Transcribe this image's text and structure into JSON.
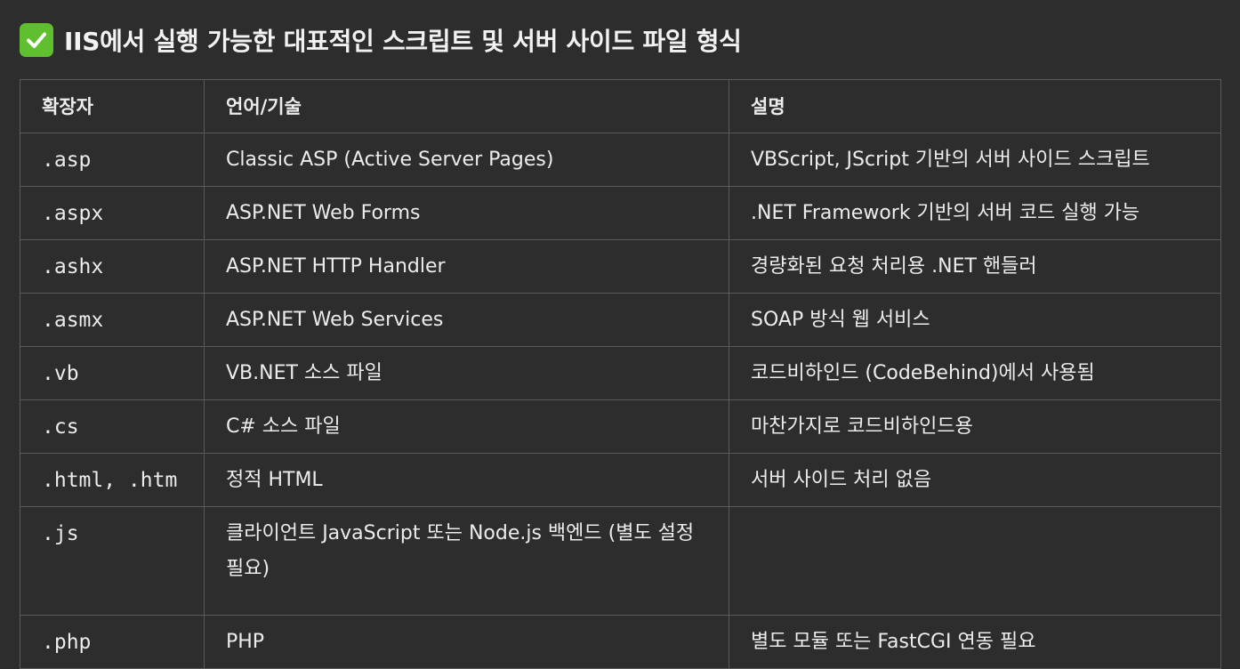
{
  "heading": {
    "icon": "check-mark-button-icon",
    "text": "IIS에서 실행 가능한 대표적인 스크립트 및 서버 사이드 파일 형식"
  },
  "table": {
    "headers": [
      "확장자",
      "언어/기술",
      "설명"
    ],
    "rows": [
      {
        "ext": ".asp",
        "tech": "Classic ASP (Active Server Pages)",
        "desc": "VBScript, JScript 기반의 서버 사이드 스크립트"
      },
      {
        "ext": ".aspx",
        "tech": "ASP.NET Web Forms",
        "desc": ".NET Framework 기반의 서버 코드 실행 가능"
      },
      {
        "ext": ".ashx",
        "tech": "ASP.NET HTTP Handler",
        "desc": "경량화된 요청 처리용 .NET 핸들러"
      },
      {
        "ext": ".asmx",
        "tech": "ASP.NET Web Services",
        "desc": "SOAP 방식 웹 서비스"
      },
      {
        "ext": ".vb",
        "tech": "VB.NET 소스 파일",
        "desc": "코드비하인드 (CodeBehind)에서 사용됨"
      },
      {
        "ext": ".cs",
        "tech": "C# 소스 파일",
        "desc": "마찬가지로 코드비하인드용"
      },
      {
        "ext": ".html, .htm",
        "tech": "정적 HTML",
        "desc": "서버 사이드 처리 없음"
      },
      {
        "ext": ".js",
        "tech": "클라이언트 JavaScript 또는 Node.js 백엔드 (별도 설정 필요)",
        "desc": ""
      },
      {
        "ext": ".php",
        "tech": "PHP",
        "desc": "별도 모듈 또는 FastCGI 연동 필요"
      }
    ]
  },
  "colors": {
    "background": "#2d2d2d",
    "border": "#5a5a5a",
    "text": "#ececec",
    "check_icon": "#5fbf2e"
  }
}
